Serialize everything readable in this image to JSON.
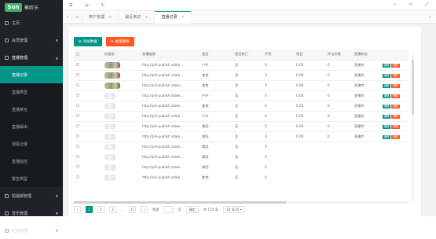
{
  "sidebar": {
    "logo_mark": "Sun",
    "logo_text": "聚听乐",
    "items": [
      {
        "label": "主页"
      },
      {
        "label": "会员管理"
      },
      {
        "label": "直播管理",
        "open": true
      },
      {
        "label": "短视频管理"
      },
      {
        "label": "音乐管理"
      },
      {
        "label": "礼物管理"
      }
    ],
    "subitems": [
      "直播记录",
      "直播类型",
      "直播禁言",
      "直播踢出",
      "观看记录",
      "直播监控",
      "警告类型"
    ]
  },
  "topbar": {
    "icons": [
      "menu-icon",
      "globe-icon",
      "refresh-icon"
    ],
    "right_icons": [
      "message-icon",
      "lock-icon",
      "fullscreen-icon"
    ]
  },
  "tabs": [
    {
      "label": "用户管理"
    },
    {
      "label": "最近来访"
    },
    {
      "label": "直播记录",
      "active": true
    }
  ],
  "toolbar": {
    "add_label": "添加数据",
    "delete_label": "批量删除"
  },
  "table": {
    "headers": [
      "",
      "封面图",
      "直播链接",
      "类型",
      "是否热门",
      "开关",
      "钻石",
      "评论次数",
      "直播状态",
      ""
    ],
    "rows": [
      [
        "http://pili-publish.sdale...",
        "户外",
        "否",
        "0",
        "0.00",
        "0",
        "直播完",
        "real"
      ],
      [
        "http://pili-publish.sdale...",
        "美食",
        "否",
        "0",
        "0.00",
        "0",
        "直播完",
        "real"
      ],
      [
        "http://pili-publish.sdale...",
        "美食",
        "否",
        "0",
        "0.00",
        "0",
        "直播完",
        "real"
      ],
      [
        "http://pili-publish.sdale...",
        "户外",
        "否",
        "0",
        "0.00",
        "0",
        "直播完",
        "blur"
      ],
      [
        "http://pili-publish.sdale...",
        "美食",
        "否",
        "0",
        "0.00",
        "0",
        "直播完",
        "blur"
      ],
      [
        "http://pili-publish.sdale...",
        "户外",
        "否",
        "0",
        "0.00",
        "0",
        "直播完",
        "blur"
      ],
      [
        "http://pili-publish.sdale...",
        "舞蹈",
        "否",
        "0",
        "0.00",
        "0",
        "直播完",
        "blur"
      ],
      [
        "http://pili-publish.sdale...",
        "舞蹈",
        "否",
        "0",
        "0.00",
        "0",
        "直播完",
        "blur"
      ],
      [
        "http://pili-publish.sdale...",
        "舞蹈",
        "否",
        "0",
        "",
        "",
        "",
        "blur"
      ],
      [
        "http://pili-publish.sdale...",
        "舞蹈",
        "否",
        "0",
        "",
        "",
        "",
        "blur"
      ],
      [
        "http://pili-publish.sdale...",
        "舞蹈",
        "否",
        "0",
        "",
        "",
        "",
        "blur"
      ],
      [
        "http://pili-publish.sdale...",
        "美食",
        "否",
        "0",
        "",
        "",
        "",
        "blur"
      ]
    ],
    "ops": {
      "edit": "编辑",
      "del": "删除"
    }
  },
  "pager": {
    "pages": [
      "1",
      "2",
      "3",
      "...",
      "6"
    ],
    "goto_label": "到第",
    "page_label": "页",
    "confirm": "确定",
    "total": "共 115 条",
    "per_page": "20 条/页"
  }
}
